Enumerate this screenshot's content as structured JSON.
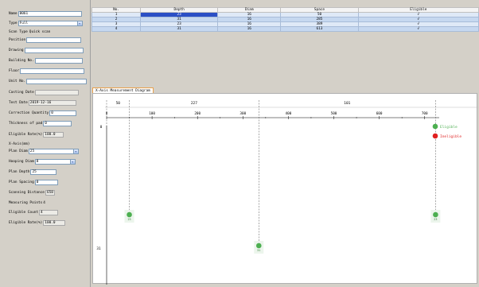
{
  "left_panel": {
    "name": {
      "label": "Name",
      "value": "0061"
    },
    "type": {
      "label": "Type",
      "value": "Full"
    },
    "scan_type": {
      "label": "Scan Type",
      "value": "Quick scan"
    },
    "position": {
      "label": "Position",
      "value": ""
    },
    "drawing": {
      "label": "Drawing",
      "value": ""
    },
    "building_no": {
      "label": "Building No.",
      "value": ""
    },
    "floor": {
      "label": "Floor",
      "value": ""
    },
    "unit_no": {
      "label": "Unit No.",
      "value": ""
    },
    "casting_date": {
      "label": "Casting Date",
      "value": ""
    },
    "test_date": {
      "label": "Test Date",
      "value": "2019-12-16"
    },
    "correction_quantity": {
      "label": "Correction Quantity",
      "value": "0"
    },
    "thickness_of_pad": {
      "label": "Thickness of pad",
      "value": "0"
    },
    "eligible_rate_1": {
      "label": "Eligible Rate(%)",
      "value": "100.0"
    },
    "section_label": "X-Axis(mm)",
    "plan_diam": {
      "label": "Plan Diam",
      "value": "25"
    },
    "hooping_diam": {
      "label": "Hooping Diam",
      "value": "8"
    },
    "plan_depth": {
      "label": "Plan Depth",
      "value": "25"
    },
    "plan_spacing": {
      "label": "Plan Spacing",
      "value": "0"
    },
    "scanning_distance": {
      "label": "Scanning Distance",
      "value": "658"
    },
    "measuring_points": {
      "label": "Measuring Points",
      "value": "4"
    },
    "eligible_count": {
      "label": "Eligible Count",
      "value": "4"
    },
    "eligible_rate_2": {
      "label": "Eligible Rate(%)",
      "value": "100.0"
    }
  },
  "table": {
    "headers": [
      "No.",
      "Depth",
      "Diam",
      "Space",
      "Eligible"
    ],
    "rows": [
      [
        "1",
        "23",
        "16",
        "50",
        "√"
      ],
      [
        "2",
        "31",
        "16",
        "285",
        "√"
      ],
      [
        "3",
        "23",
        "16",
        "389",
        "√"
      ],
      [
        "4",
        "31",
        "16",
        "613",
        "√"
      ]
    ]
  },
  "diagram": {
    "tab_label": "X-Axis Measurement Diagram",
    "spacing_labels": [
      "50",
      "227",
      "101",
      "224"
    ],
    "x_ticks": [
      "0",
      "100",
      "200",
      "300",
      "400",
      "500",
      "600",
      "700"
    ],
    "y_labels": [
      "0",
      "31"
    ],
    "point_labels": [
      "23",
      "31",
      "23",
      "31"
    ],
    "legend": {
      "eligible": "Eligible",
      "ineligible": "Ineligible",
      "eligible_color": "#4caf50",
      "ineligible_color": "#e02020"
    }
  }
}
